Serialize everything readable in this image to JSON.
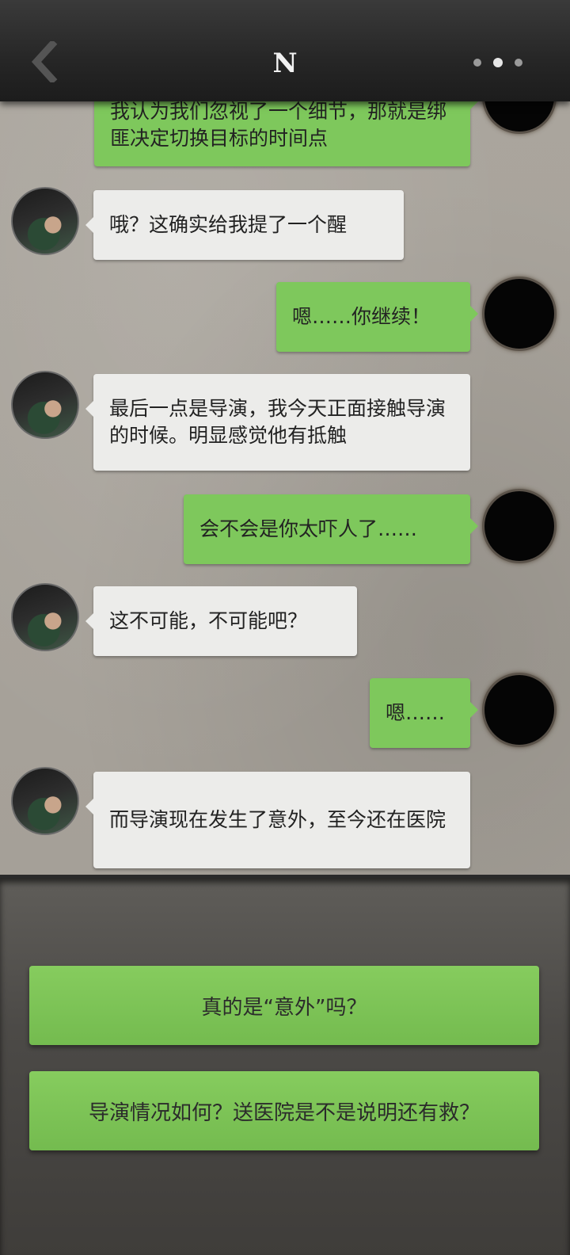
{
  "header": {
    "title": "N",
    "back_icon": "chevron-left-icon",
    "more_icon": "more-dots-icon"
  },
  "messages": [
    {
      "sender": "me",
      "text": "我认为我们忽视了一个细节，那就是绑匪决定切换目标的时间点"
    },
    {
      "sender": "contact",
      "text": "哦？这确实给我提了一个醒"
    },
    {
      "sender": "me",
      "text": "嗯……你继续！"
    },
    {
      "sender": "contact",
      "text": "最后一点是导演，我今天正面接触导演的时候。明显感觉他有抵触"
    },
    {
      "sender": "me",
      "text": "会不会是你太吓人了……"
    },
    {
      "sender": "contact",
      "text": "这不可能，不可能吧？"
    },
    {
      "sender": "me",
      "text": "嗯……"
    },
    {
      "sender": "contact",
      "text": "而导演现在发生了意外，至今还在医院"
    }
  ],
  "choices": [
    {
      "label": "真的是“意外”吗？"
    },
    {
      "label": "导演情况如何？送医院是不是说明还有救？"
    }
  ],
  "colors": {
    "outgoing_bubble": "#7ec85c",
    "incoming_bubble": "#ececea",
    "header_bg": "#262626",
    "choice_button": "#7ec85c"
  }
}
